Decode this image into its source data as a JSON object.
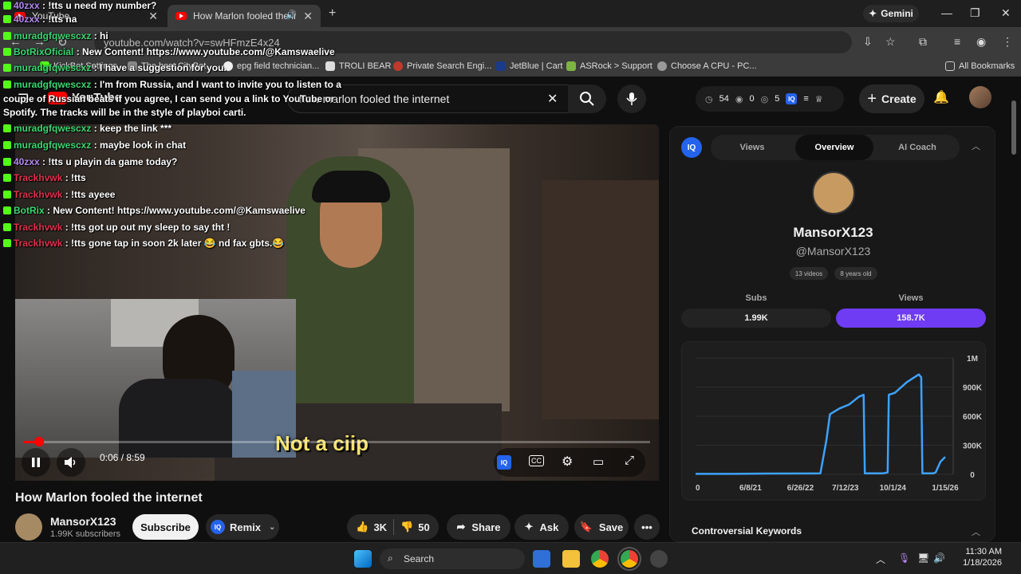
{
  "tabs": [
    {
      "title": "YouTube"
    },
    {
      "title": "How Marlon fooled the inte"
    }
  ],
  "gemini_label": "Gemini",
  "address": "youtube.com/watch?v=swHFmzE4x24",
  "bookmarks": [
    {
      "label": "KickBot Settings"
    },
    {
      "label": "The best CityBot"
    },
    {
      "label": "epg field technician..."
    },
    {
      "label": "TROLI BEAR"
    },
    {
      "label": "Private Search Engi..."
    },
    {
      "label": "JetBlue | Cart"
    },
    {
      "label": "ASRock > Support"
    },
    {
      "label": "Choose A CPU - PC..."
    },
    {
      "label": "All Bookmarks"
    }
  ],
  "youtube": {
    "logo": "YouTube",
    "search_value": "how marlon fooled the internet",
    "stats": {
      "a": "54",
      "b": "0",
      "c": "5"
    },
    "create_label": "Create"
  },
  "chat": [
    {
      "user": "40zxx",
      "msg": ": !tts u need my number?",
      "color": "u1"
    },
    {
      "user": "40zxx",
      "msg": ": !tts na",
      "color": "u1"
    },
    {
      "user": "muradgfqwescxz",
      "msg": ": hi",
      "color": "u2"
    },
    {
      "user": "BotRixOficial",
      "msg": ": New Content! https://www.youtube.com/@Kamswaelive",
      "color": "u2"
    },
    {
      "user": "muradgfqwescxz",
      "msg": ": I have a suggestion for you.",
      "color": "u2"
    },
    {
      "user": "muradgfqwescxz",
      "msg": ": I'm from Russia, and I want to invite you to listen to a",
      "color": "u2"
    },
    {
      "user": "",
      "msg": "couple of Russian beats if you agree, I can send you a link to YouTube or",
      "color": "u2"
    },
    {
      "user": "",
      "msg": "Spotify. The tracks will be in the style of playboi carti.",
      "color": "u2"
    },
    {
      "user": "muradgfqwescxz",
      "msg": ": keep the link ***",
      "color": "u2"
    },
    {
      "user": "muradgfqwescxz",
      "msg": ": maybe look in chat",
      "color": "u2"
    },
    {
      "user": "40zxx",
      "msg": ": !tts u playin da game today?",
      "color": "u1"
    },
    {
      "user": "Trackhvwk",
      "msg": ": !tts",
      "color": "u3"
    },
    {
      "user": "Trackhvwk",
      "msg": ": !tts ayeee",
      "color": "u3"
    },
    {
      "user": "BotRix",
      "msg": ": New Content! https://www.youtube.com/@Kamswaelive",
      "color": "u2"
    },
    {
      "user": "Trackhvwk",
      "msg": ": !tts got up out my sleep to say tht !",
      "color": "u3"
    },
    {
      "user": "Trackhvwk",
      "msg": ": !tts gone tap in soon 2k later 😂 nd fax gbts.😂",
      "color": "u3"
    }
  ],
  "video": {
    "subtitle": "Not a ciip",
    "time": "0:06 / 8:59",
    "progress": 0.011,
    "title": "How Marlon fooled the internet"
  },
  "channel": {
    "name": "MansorX123",
    "subs": "1.99K subscribers",
    "subscribe_label": "Subscribe",
    "remix_label": "Remix"
  },
  "actions": {
    "likes": "3K",
    "dislikes": "50",
    "share": "Share",
    "ask": "Ask",
    "save": "Save"
  },
  "panel": {
    "tabs": [
      "Views",
      "Overview",
      "AI Coach"
    ],
    "name": "MansorX123",
    "handle": "@MansorX123",
    "chips": [
      "13 videos",
      "8 years old"
    ],
    "subs_label": "Subs",
    "subs_value": "1.99K",
    "views_label": "Views",
    "views_value": "158.7K",
    "keywords_heading": "Controversial Keywords"
  },
  "chart_data": {
    "type": "line",
    "title": "",
    "x_ticks": [
      "0",
      "6/8/21",
      "6/26/22",
      "7/12/23",
      "10/1/24",
      "1/15/26"
    ],
    "y_ticks": [
      "0",
      "300K",
      "600K",
      "900K",
      "1M"
    ],
    "ylim": [
      0,
      1200000
    ],
    "x": [
      0,
      0.15,
      0.3,
      0.52,
      0.545,
      0.56,
      0.6,
      0.64,
      0.68,
      0.7,
      0.705,
      0.78,
      0.8,
      0.805,
      0.83,
      0.88,
      0.93,
      0.94,
      0.945,
      0.99,
      1.0,
      1.02,
      1.04
    ],
    "values": [
      5000,
      5000,
      8000,
      10000,
      350000,
      620000,
      680000,
      720000,
      800000,
      820000,
      10000,
      10000,
      20000,
      820000,
      840000,
      950000,
      1030000,
      1000000,
      10000,
      10000,
      20000,
      130000,
      180000
    ],
    "color": "#3da2ff"
  },
  "taskbar": {
    "search": "Search",
    "time": "11:30 AM",
    "date": "1/18/2026"
  },
  "colors": {
    "accent": "#6f3cf3",
    "brand_red": "#ff0000"
  }
}
